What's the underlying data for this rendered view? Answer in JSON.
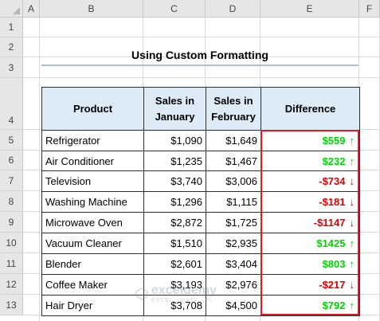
{
  "sheet": {
    "columns": [
      "A",
      "B",
      "C",
      "D",
      "E",
      "F"
    ],
    "rows": [
      "1",
      "2",
      "3",
      "4",
      "5",
      "6",
      "7",
      "8",
      "9",
      "10",
      "11",
      "12",
      "13"
    ]
  },
  "title": "Using Custom Formatting",
  "table": {
    "headers": {
      "product": "Product",
      "jan_line1": "Sales in",
      "jan_line2": "January",
      "feb_line1": "Sales in",
      "feb_line2": "February",
      "difference": "Difference"
    },
    "rows": [
      {
        "product": "Refrigerator",
        "jan": "$1,090",
        "feb": "$1,649",
        "diff": "$559",
        "dir": "up"
      },
      {
        "product": "Air Conditioner",
        "jan": "$1,235",
        "feb": "$1,467",
        "diff": "$232",
        "dir": "up"
      },
      {
        "product": "Television",
        "jan": "$3,740",
        "feb": "$3,006",
        "diff": "-$734",
        "dir": "down"
      },
      {
        "product": "Washing Machine",
        "jan": "$1,296",
        "feb": "$1,115",
        "diff": "-$181",
        "dir": "down"
      },
      {
        "product": "Microwave Oven",
        "jan": "$2,872",
        "feb": "$1,725",
        "diff": "-$1147",
        "dir": "down"
      },
      {
        "product": "Vacuum Cleaner",
        "jan": "$1,510",
        "feb": "$2,935",
        "diff": "$1425",
        "dir": "up"
      },
      {
        "product": "Blender",
        "jan": "$2,601",
        "feb": "$3,404",
        "diff": "$803",
        "dir": "up"
      },
      {
        "product": "Coffee Maker",
        "jan": "$3,193",
        "feb": "$2,976",
        "diff": "-$217",
        "dir": "down"
      },
      {
        "product": "Hair Dryer",
        "jan": "$3,708",
        "feb": "$4,500",
        "diff": "$792",
        "dir": "up"
      }
    ]
  },
  "colors": {
    "up": "#00d400",
    "down": "#e00000",
    "header_fill": "#ddebf7",
    "highlight_border": "#e8141e"
  },
  "icons": {
    "up": "up-arrow-icon",
    "down": "down-arrow-icon"
  },
  "watermark": {
    "brand": "exceldemy",
    "tagline": "EXCEL · DATA · BI"
  }
}
